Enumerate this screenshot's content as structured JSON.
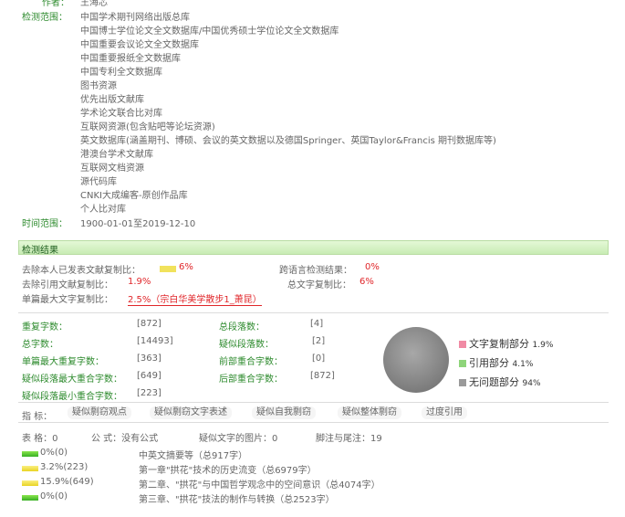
{
  "header": {
    "author_label": "作者：",
    "author_value": "王海芯",
    "scope_label": "检测范围：",
    "scope_items": [
      "中国学术期刊网络出版总库",
      "中国博士学位论文全文数据库/中国优秀硕士学位论文全文数据库",
      "中国重要会议论文全文数据库",
      "中国重要报纸全文数据库",
      "中国专利全文数据库",
      "图书资源",
      "优先出版文献库",
      "学术论文联合比对库",
      "互联网资源(包含贴吧等论坛资源)",
      "英文数据库(涵盖期刊、博硕、会议的英文数据以及德国Springer、英国Taylor&Francis 期刊数据库等)",
      "港澳台学术文献库",
      "互联网文档资源",
      "源代码库",
      "CNKI大成编客-原创作品库",
      "个人比对库"
    ],
    "time_label": "时间范围：",
    "time_value": "1900-01-01至2019-12-10"
  },
  "result": {
    "title": "检测结果",
    "self_removed_label": "去除本人已发表文献复制比：",
    "self_removed_value": "6%",
    "cross_lang_label": "跨语言检测结果：",
    "cross_lang_value": "0%",
    "quote_removed_label": "去除引用文献复制比：",
    "quote_removed_value": "1.9%",
    "total_label": "总文字复制比：",
    "total_value": "6%",
    "single_max_label": "单篇最大文字复制比：",
    "single_max_value": "2.5%（宗白华美学散步1_萧昆）"
  },
  "stats": {
    "dup_chars_label": "重复字数：",
    "dup_chars_value": "[872]",
    "total_chars_label": "总字数：",
    "total_chars_value": "[14493]",
    "single_max_dup_label": "单篇最大重复字数：",
    "single_max_dup_value": "[363]",
    "sus_para_max_label": "疑似段落最大重合字数：",
    "sus_para_max_value": "[649]",
    "sus_para_min_label": "疑似段落最小重合字数：",
    "sus_para_min_value": "[223]",
    "total_paras_label": "总段落数：",
    "total_paras_value": "[4]",
    "sus_paras_label": "疑似段落数：",
    "sus_paras_value": "[2]",
    "front_overlap_label": "前部重合字数：",
    "front_overlap_value": "[0]",
    "back_overlap_label": "后部重合字数：",
    "back_overlap_value": "[872]"
  },
  "legend": {
    "copy_label": "文字复制部分",
    "copy_value": "1.9%",
    "cite_label": "引用部分",
    "cite_value": "4.1%",
    "clean_label": "无问题部分",
    "clean_value": "94%",
    "copy_color": "#f08aa4",
    "cite_color": "#8ed47a",
    "clean_color": "#9a9a9a"
  },
  "filters": {
    "label": "指  标：",
    "items": [
      "疑似剽窃观点",
      "疑似剽窃文字表述",
      "疑似自我剽窃",
      "疑似整体剽窃",
      "过度引用"
    ]
  },
  "meta_row": {
    "tables": "表 格：0",
    "formulas": "公 式：没有公式",
    "images": "疑似文字的图片：0",
    "notes": "脚注与尾注：19"
  },
  "sections": [
    {
      "percent": "0%(0)",
      "title": "中英文摘要等（总917字）",
      "fraction": 0.0
    },
    {
      "percent": "3.2%(223)",
      "title": "第一章\"拱花\"技术的历史流变（总6979字）",
      "fraction": 0.032
    },
    {
      "percent": "15.9%(649)",
      "title": "第二章、\"拱花\"与中国哲学观念中的空间意识（总4074字）",
      "fraction": 0.159
    },
    {
      "percent": "0%(0)",
      "title": "第三章、\"拱花\"技法的制作与转换（总2523字）",
      "fraction": 0.0
    }
  ]
}
